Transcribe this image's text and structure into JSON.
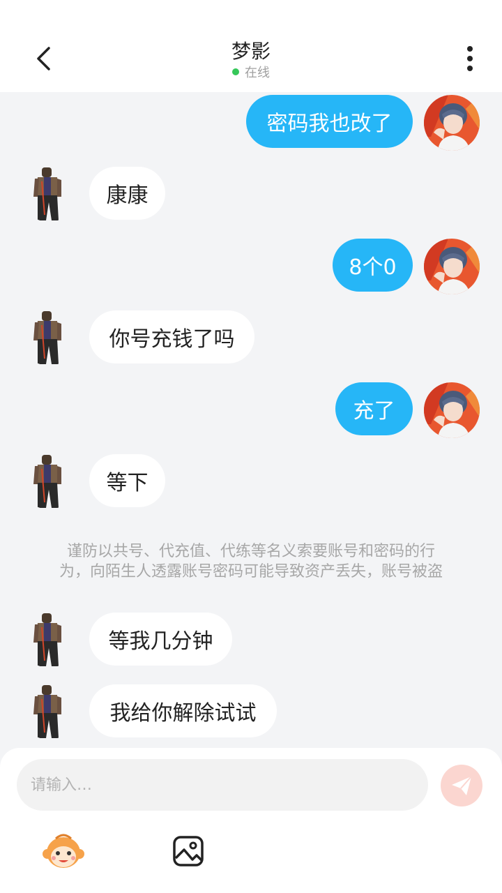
{
  "header": {
    "title": "梦影",
    "status": "在线"
  },
  "messages": [
    {
      "from": "me",
      "text": "密码我也改了"
    },
    {
      "from": "them",
      "text": "康康"
    },
    {
      "from": "me",
      "text": "8个0"
    },
    {
      "from": "them",
      "text": "你号充钱了吗"
    },
    {
      "from": "me",
      "text": "充了"
    },
    {
      "from": "them",
      "text": "等下"
    },
    {
      "from": "them",
      "text": "等我几分钟"
    },
    {
      "from": "them",
      "text": "我给你解除试试"
    }
  ],
  "notice": {
    "line1": "谨防以共号、代充值、代练等名义索要账号和密码的行",
    "line2": "为，向陌生人透露账号密码可能导致资产丢失，账号被盗"
  },
  "composer": {
    "placeholder": "请输入…"
  },
  "colors": {
    "outgoing_bubble": "#26b6f7",
    "incoming_bubble": "#ffffff",
    "online_dot": "#35c759",
    "send_button": "#fbd6d0"
  },
  "icons": {
    "back": "chevron-left-icon",
    "more": "more-vertical-icon",
    "send": "send-icon",
    "emoji": "monkey-emoji-icon",
    "image": "image-icon"
  }
}
